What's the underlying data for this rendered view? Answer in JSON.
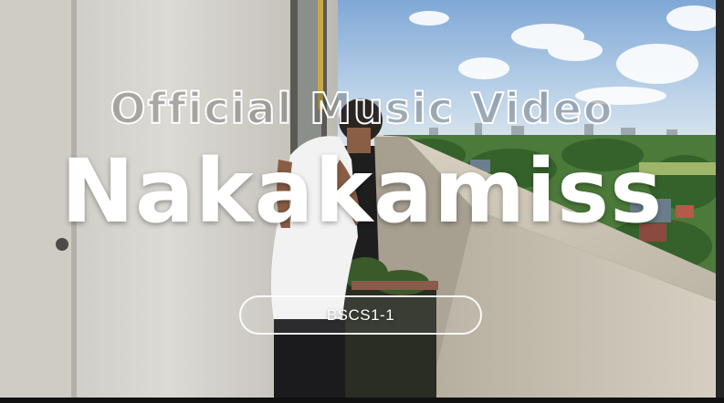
{
  "video": {
    "heading": "Official Music Video",
    "song_title": "Nakakamiss",
    "section_label": "BSCS1-1"
  },
  "scene": {
    "description_icons": [
      "building-wall",
      "person",
      "balcony-parapet",
      "city-skyline",
      "sky-clouds"
    ],
    "colors": {
      "sky": "#aecbe6",
      "wall": "#d7d5cf",
      "parapet": "#c9c2b4",
      "foliage": "#3e6b2f",
      "shirt": "#f2f2f2"
    }
  }
}
